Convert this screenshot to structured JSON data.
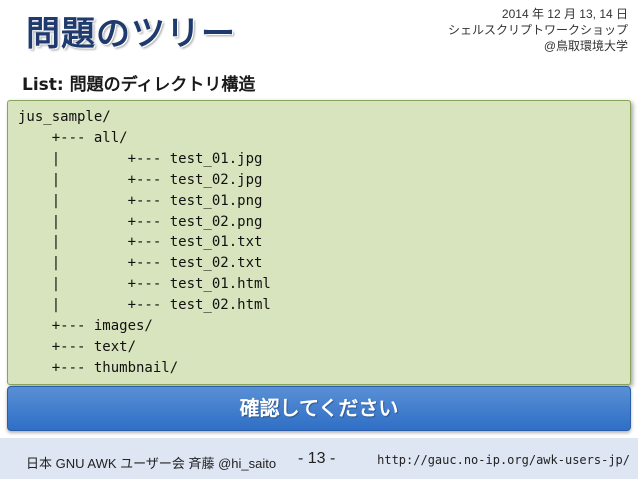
{
  "slide": {
    "title": "問題のツリー",
    "info": [
      "2014 年 12 月 13, 14 日",
      "シェルスクリプトワークショップ",
      "@鳥取環境大学"
    ],
    "subtitle": "List: 問題のディレクトリ構造",
    "code_lines": [
      "jus_sample/",
      "    +--- all/",
      "    |        +--- test_01.jpg",
      "    |        +--- test_02.jpg",
      "    |        +--- test_01.png",
      "    |        +--- test_02.png",
      "    |        +--- test_01.txt",
      "    |        +--- test_02.txt",
      "    |        +--- test_01.html",
      "    |        +--- test_02.html",
      "    +--- images/",
      "    +--- text/",
      "    +--- thumbnail/"
    ],
    "confirm_label": "確認してください"
  },
  "footer": {
    "left": "日本 GNU AWK ユーザー会 斉藤 @hi_saito",
    "page": "- 13 -",
    "url": "http://gauc.no-ip.org/awk-users-jp/"
  },
  "colors": {
    "title": "#1f3a6e",
    "code_bg": "#d8e4bd",
    "confirm_bg": "#2f6fc5",
    "footer_bg": "#dde6f2"
  }
}
